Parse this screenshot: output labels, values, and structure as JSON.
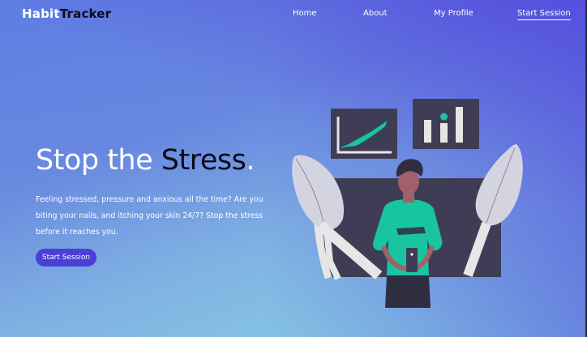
{
  "nav": {
    "logo_light": "Habit",
    "logo_dark": "Tracker",
    "links": {
      "home": "Home",
      "about": "About",
      "profile": "My Profile",
      "start": "Start Session"
    }
  },
  "hero": {
    "title_light": "Stop the",
    "title_dark": "Stress",
    "title_end": ".",
    "description": "Feeling stressed, pressure and anxious all the time? Are you biting your nails, and itching your skin 24/7? Stop the stress before it reaches you.",
    "button_label": "Start Session"
  },
  "colors": {
    "accent": "#4c3fd8",
    "figure_shirt": "#19c4a0",
    "panel": "#3f3d56"
  },
  "icons": {
    "illustration": "person-with-phone-illustration"
  }
}
